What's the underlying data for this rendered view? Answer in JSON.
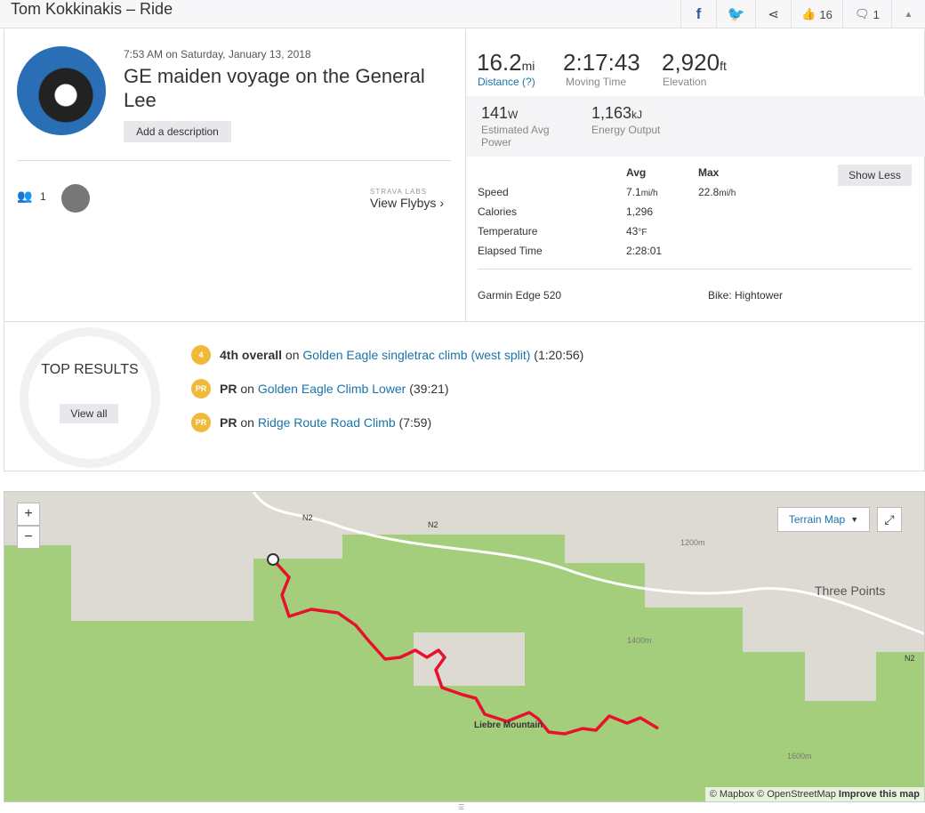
{
  "header": {
    "title": "Tom Kokkinakis – Ride",
    "kudos_count": "16",
    "comment_count": "1"
  },
  "activity": {
    "datetime": "7:53 AM on Saturday, January 13, 2018",
    "name": "GE maiden voyage on the General Lee",
    "add_description": "Add a description",
    "athlete_count": "1",
    "flyby_label": "STRAVA LABS",
    "flyby_link": "View Flybys"
  },
  "stats": {
    "distance": {
      "value": "16.2",
      "unit": "mi",
      "label": "Distance (?)"
    },
    "moving_time": {
      "value": "2:17:43",
      "label": "Moving Time"
    },
    "elevation": {
      "value": "2,920",
      "unit": "ft",
      "label": "Elevation"
    },
    "power": {
      "value": "141",
      "unit": "W",
      "label": "Estimated Avg Power"
    },
    "energy": {
      "value": "1,163",
      "unit": "kJ",
      "label": "Energy Output"
    },
    "col_avg": "Avg",
    "col_max": "Max",
    "show_less": "Show Less",
    "rows": [
      {
        "label": "Speed",
        "avg": "7.1",
        "avg_unit": "mi/h",
        "max": "22.8",
        "max_unit": "mi/h"
      },
      {
        "label": "Calories",
        "avg": "1,296"
      },
      {
        "label": "Temperature",
        "avg": "43",
        "avg_unit": "°F"
      },
      {
        "label": "Elapsed Time",
        "avg": "2:28:01"
      }
    ],
    "device": "Garmin Edge 520",
    "bike": "Bike: Hightower"
  },
  "results": {
    "title": "TOP RESULTS",
    "view_all": "View all",
    "items": [
      {
        "badge": "4",
        "rank": "4th overall",
        "on": " on ",
        "segment": "Golden Eagle singletrac climb (west split)",
        "time": " (1:20:56)"
      },
      {
        "badge": "PR",
        "rank": "PR",
        "on": " on ",
        "segment": "Golden Eagle Climb Lower",
        "time": " (39:21)"
      },
      {
        "badge": "PR",
        "rank": "PR",
        "on": " on ",
        "segment": "Ridge Route Road Climb",
        "time": " (7:59)"
      }
    ]
  },
  "map": {
    "zoom_in": "+",
    "zoom_out": "−",
    "layer": "Terrain Map",
    "labels": {
      "three_points": "Three Points",
      "liebre": "Liebre Mountain",
      "n2": "N2",
      "e1200": "1200m",
      "e1400": "1400m",
      "e1600": "1600m"
    },
    "attribution": "© Mapbox © OpenStreetMap",
    "improve": "Improve this map",
    "route_color": "#e8112d"
  }
}
